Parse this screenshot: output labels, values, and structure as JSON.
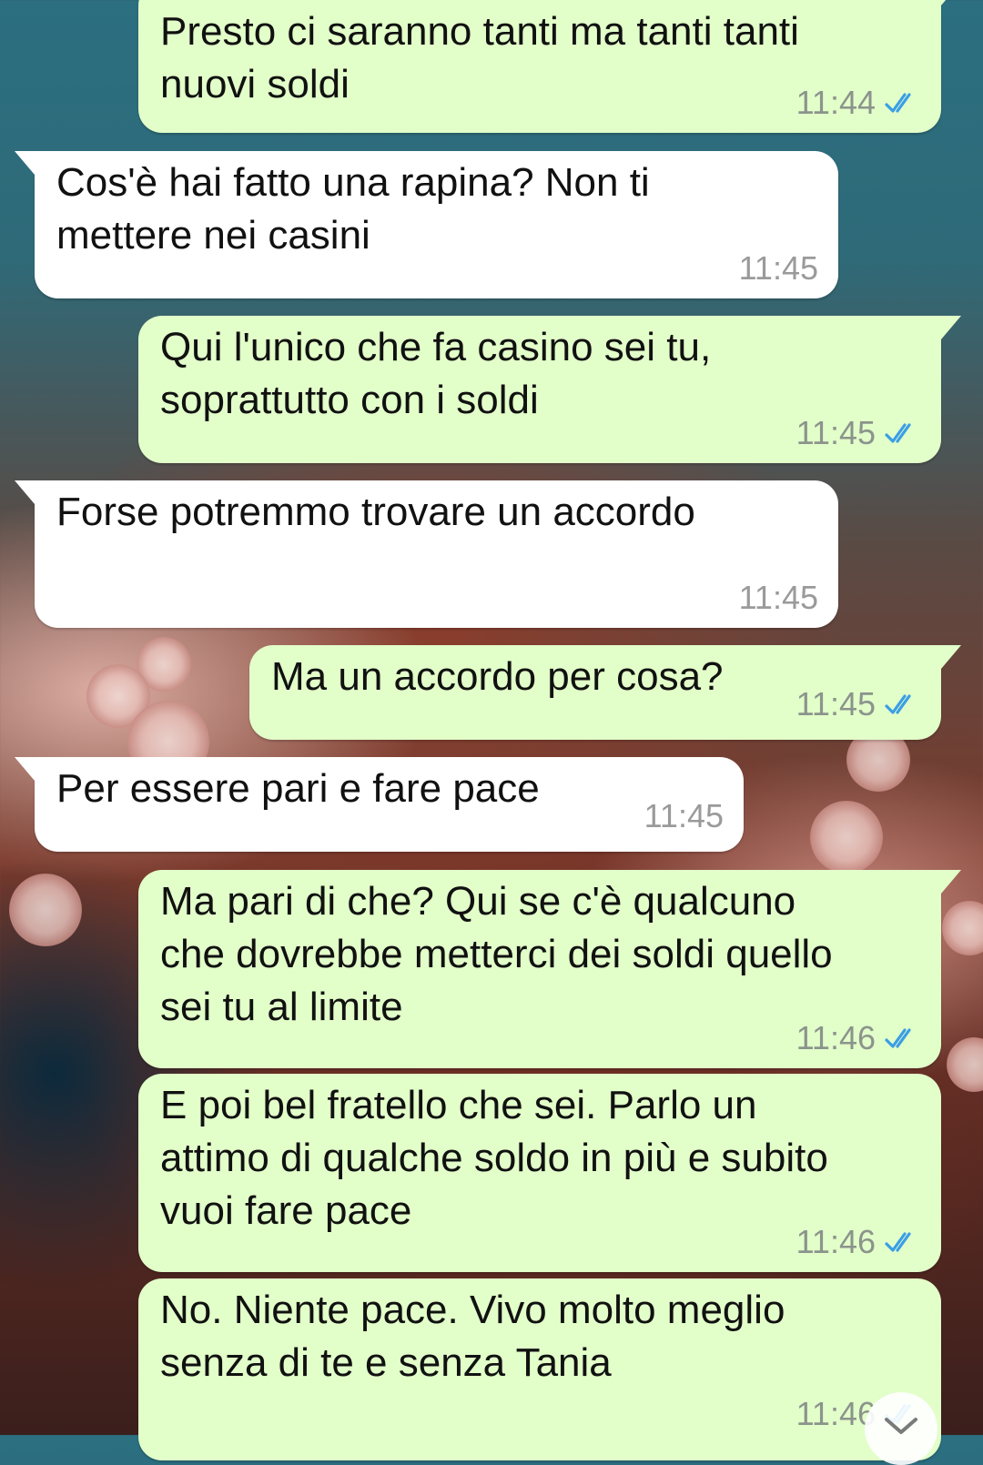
{
  "chat": {
    "messages": [
      {
        "dir": "out",
        "text": "Presto ci saranno tanti ma tanti tanti\nnuovi soldi",
        "time": "11:44",
        "read": true
      },
      {
        "dir": "in",
        "text": "Cos'è hai fatto una rapina? Non ti\nmettere nei casini",
        "time": "11:45"
      },
      {
        "dir": "out",
        "text": "Qui l'unico che fa casino sei tu,\nsoprattutto con i soldi",
        "time": "11:45",
        "read": true
      },
      {
        "dir": "in",
        "text": "Forse potremmo trovare un accordo",
        "time": "11:45"
      },
      {
        "dir": "out",
        "text": "Ma un accordo per cosa?",
        "time": "11:45",
        "read": true
      },
      {
        "dir": "in",
        "text": "Per essere pari e fare pace",
        "time": "11:45"
      },
      {
        "dir": "out",
        "text": "Ma pari di che? Qui se c'è qualcuno\nche dovrebbe metterci dei soldi quello\nsei tu al limite",
        "time": "11:46",
        "read": true
      },
      {
        "dir": "out",
        "text": "E poi bel fratello che sei. Parlo un\nattimo di qualche soldo in più e subito\nvuoi fare pace",
        "time": "11:46",
        "read": true
      },
      {
        "dir": "out",
        "text": "No. Niente pace. Vivo molto meglio\nsenza di te e senza Tania",
        "time": "11:46",
        "read": true
      }
    ],
    "read_tick_color": "#3b9ee6",
    "icons": {
      "read": "double-check-icon",
      "scroll": "chevron-down-icon"
    }
  }
}
